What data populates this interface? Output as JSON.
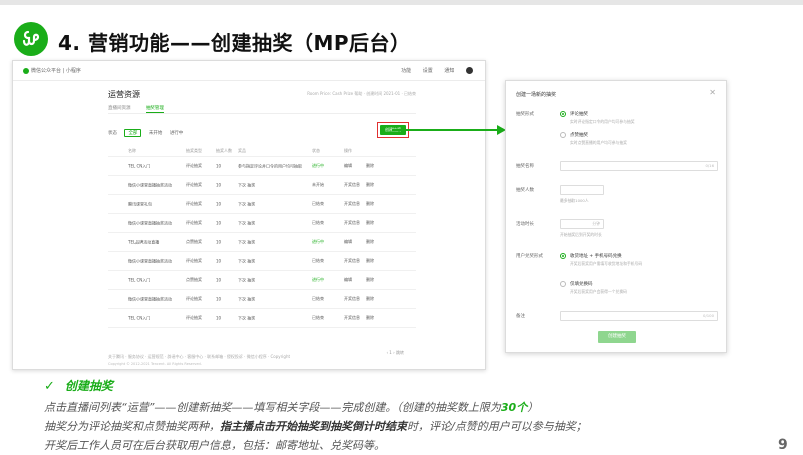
{
  "slide": {
    "title": "4. 营销功能——创建抽奖（MP后台）",
    "page_number": "9",
    "logo_icon": "miniprogram-logo-icon",
    "accent_color": "#1aad19"
  },
  "left_window": {
    "brand": "微信公众平台 | 小程序",
    "nav": [
      "功能",
      "设置",
      "通知"
    ],
    "heading": "运营资源",
    "meta": "Room Price: Cash Prize 帮助 · 创建时间 2021-01 · 已结束",
    "tabs": [
      "直播间资源",
      "抽奖管理"
    ],
    "filter": {
      "label": "状态",
      "chips": [
        "全部",
        "未开始",
        "进行中"
      ]
    },
    "create_button": "创建抽奖",
    "table": {
      "headers": [
        "名称",
        "抽奖类型",
        "抽奖人数",
        "奖品",
        "状态",
        "操作",
        ""
      ],
      "rows": [
        {
          "name": "TEL CN入门",
          "type": "评论抽奖",
          "count": "10",
          "prize": "参与指定评论并口令的用户均可抽取",
          "status": "进行中",
          "op1": "编辑",
          "op2": "删除"
        },
        {
          "name": "微信小课堂直播抽奖活动",
          "type": "评论抽奖",
          "count": "10",
          "prize": "下次 抽奖",
          "status": "未开始",
          "op1": "开奖信息",
          "op2": "删除"
        },
        {
          "name": "腾讯课堂礼包",
          "type": "评论抽奖",
          "count": "10",
          "prize": "下次 抽奖",
          "status": "已结束",
          "op1": "开奖信息",
          "op2": "删除"
        },
        {
          "name": "微信小课堂直播抽奖活动",
          "type": "评论抽奖",
          "count": "10",
          "prize": "下次 抽奖",
          "status": "已结束",
          "op1": "开奖信息",
          "op2": "删除"
        },
        {
          "name": "TEL品牌活动直播",
          "type": "点赞抽奖",
          "count": "10",
          "prize": "下次 抽奖",
          "status": "进行中",
          "op1": "编辑",
          "op2": "删除"
        },
        {
          "name": "微信小课堂直播抽奖活动",
          "type": "评论抽奖",
          "count": "10",
          "prize": "下次 抽奖",
          "status": "已结束",
          "op1": "开奖信息",
          "op2": "删除"
        },
        {
          "name": "TEL CN入门",
          "type": "点赞抽奖",
          "count": "10",
          "prize": "下次 抽奖",
          "status": "进行中",
          "op1": "编辑",
          "op2": "删除"
        },
        {
          "name": "微信小课堂直播抽奖活动",
          "type": "评论抽奖",
          "count": "10",
          "prize": "下次 抽奖",
          "status": "已结束",
          "op1": "开奖信息",
          "op2": "删除"
        },
        {
          "name": "TEL CN入门",
          "type": "评论抽奖",
          "count": "10",
          "prize": "下次 抽奖",
          "status": "已结束",
          "op1": "开奖信息",
          "op2": "删除"
        }
      ]
    },
    "pager": "‹  1  ›   跳转",
    "footer": "关于腾讯 · 服务协议 · 运营规范 · 辟谣中心 · 客服中心 · 联系邮箱 · 侵权投诉 · 微信小程序 · Copyright",
    "copyright": "Copyright © 2012-2021 Tencent. All Rights Reserved."
  },
  "dialog": {
    "title": "创建一场新的抽奖",
    "close_icon": "close-icon",
    "lottery_type": {
      "label": "抽奖形式",
      "options": [
        {
          "label": "评论抽奖",
          "desc": "实时评论指定口令的用户均可参与抽奖"
        },
        {
          "label": "点赞抽奖",
          "desc": "实时点赞直播的用户均可参与抽奖"
        }
      ]
    },
    "prize_name": {
      "label": "抽奖名称",
      "counter": "0/16"
    },
    "winners": {
      "label": "抽奖人数",
      "hint": "最多抽取1000人"
    },
    "duration": {
      "label": "活动时长",
      "unit": "分钟",
      "hint": "开始抽奖后到开奖的时长"
    },
    "receive": {
      "label": "用户兑奖形式",
      "options": [
        {
          "label": "收货地址 + 手机号码兑换",
          "desc": "开奖后获奖用户需填写收货地址和手机号码"
        },
        {
          "label": "仅填兑换码",
          "desc": "开奖后获奖用户会获得一个兑换码"
        }
      ]
    },
    "remark": {
      "label": "备注",
      "counter": "0/100"
    },
    "submit": "创建抽奖"
  },
  "bottom": {
    "check_title": "创建抽奖",
    "line1_a": "点击直播间列表“运营”——创建新抽奖——填写相关字段——完成创建。（创建的抽奖数上限为",
    "line1_b": "30个",
    "line1_c": "）",
    "line2_a": "抽奖分为评论抽奖和点赞抽奖两种，",
    "line2_b": "指主播点击开始抽奖到抽奖倒计时结束",
    "line2_c": "时，评论/点赞的用户可以参与抽奖；",
    "line3": "开奖后工作人员可在后台获取用户信息，包括：邮寄地址、兑奖码等。"
  }
}
